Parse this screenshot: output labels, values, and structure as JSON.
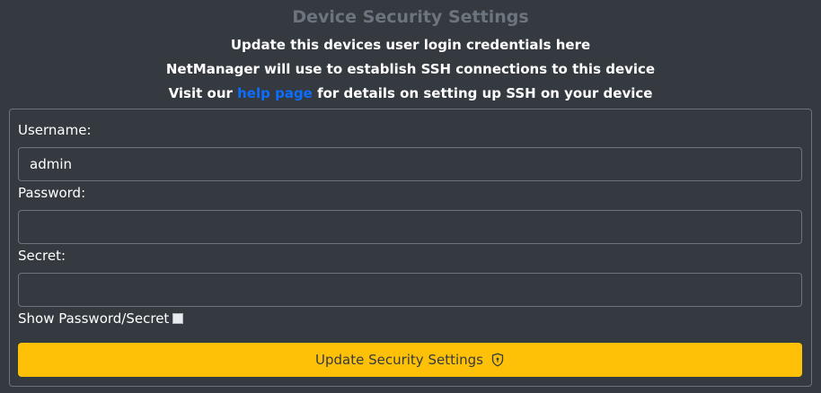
{
  "header": {
    "title": "Device Security Settings",
    "line1": "Update this devices user login credentials here",
    "line2": "NetManager will use to establish SSH connections to this device",
    "line3_prefix": "Visit our ",
    "help_link": "help page",
    "line3_suffix": " for details on setting up SSH on your device"
  },
  "form": {
    "username": {
      "label": "Username:",
      "value": "admin"
    },
    "password": {
      "label": "Password:",
      "value": ""
    },
    "secret": {
      "label": "Secret:",
      "value": ""
    },
    "show_toggle": {
      "label": "Show Password/Secret",
      "checked": false
    },
    "submit": {
      "label": "Update Security Settings",
      "icon": "shield-lock-icon"
    }
  },
  "colors": {
    "background": "#343a40",
    "title": "#6c757d",
    "link": "#0d6efd",
    "button": "#ffc107"
  }
}
